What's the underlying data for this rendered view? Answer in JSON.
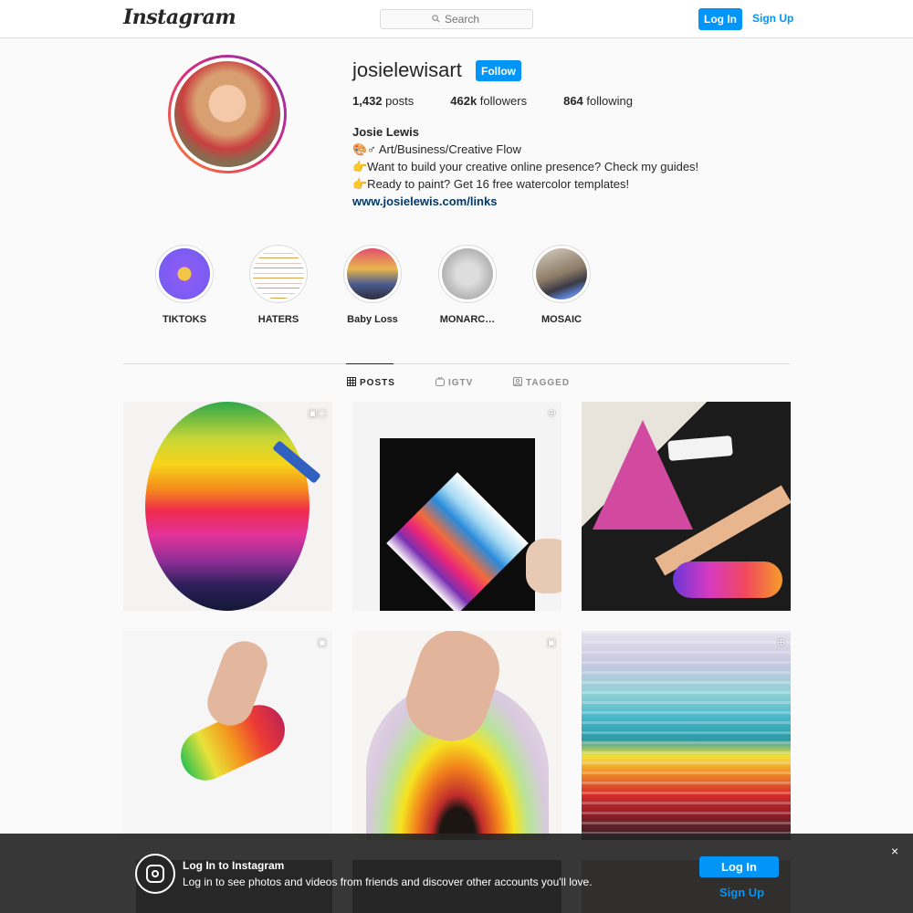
{
  "header": {
    "logo": "Instagram",
    "search_placeholder": "Search",
    "login_label": "Log In",
    "signup_label": "Sign Up"
  },
  "profile": {
    "username": "josielewisart",
    "follow_label": "Follow",
    "stats": {
      "posts_count": "1,432",
      "posts_label": "posts",
      "followers_count": "462k",
      "followers_label": "followers",
      "following_count": "864",
      "following_label": "following"
    },
    "bio": {
      "name": "Josie Lewis",
      "line1": "🎨♂ Art/Business/Creative Flow",
      "line2": "👉Want to build your creative online presence? Check my guides!",
      "line3": "👉Ready to paint? Get 16 free watercolor templates!",
      "link": "www.josielewis.com/links"
    }
  },
  "highlights": [
    {
      "label": "TIKTOKS"
    },
    {
      "label": "HATERS"
    },
    {
      "label": "Baby Loss"
    },
    {
      "label": "MONARC…"
    },
    {
      "label": "MOSAIC"
    }
  ],
  "tabs": {
    "posts": "POSTS",
    "igtv": "IGTV",
    "tagged": "TAGGED"
  },
  "overlay": {
    "title": "Log In to Instagram",
    "subtitle": "Log in to see photos and videos from friends and discover other accounts you'll love.",
    "login_label": "Log In",
    "signup_label": "Sign Up",
    "close": "×"
  },
  "icons": {
    "search": "search-icon",
    "grid": "grid-icon",
    "igtv": "igtv-icon",
    "tagged": "tagged-icon",
    "video": "video-icon",
    "multi": "carousel-icon",
    "close": "close-icon"
  },
  "colors": {
    "accent": "#0095f6",
    "link": "#00376b"
  }
}
